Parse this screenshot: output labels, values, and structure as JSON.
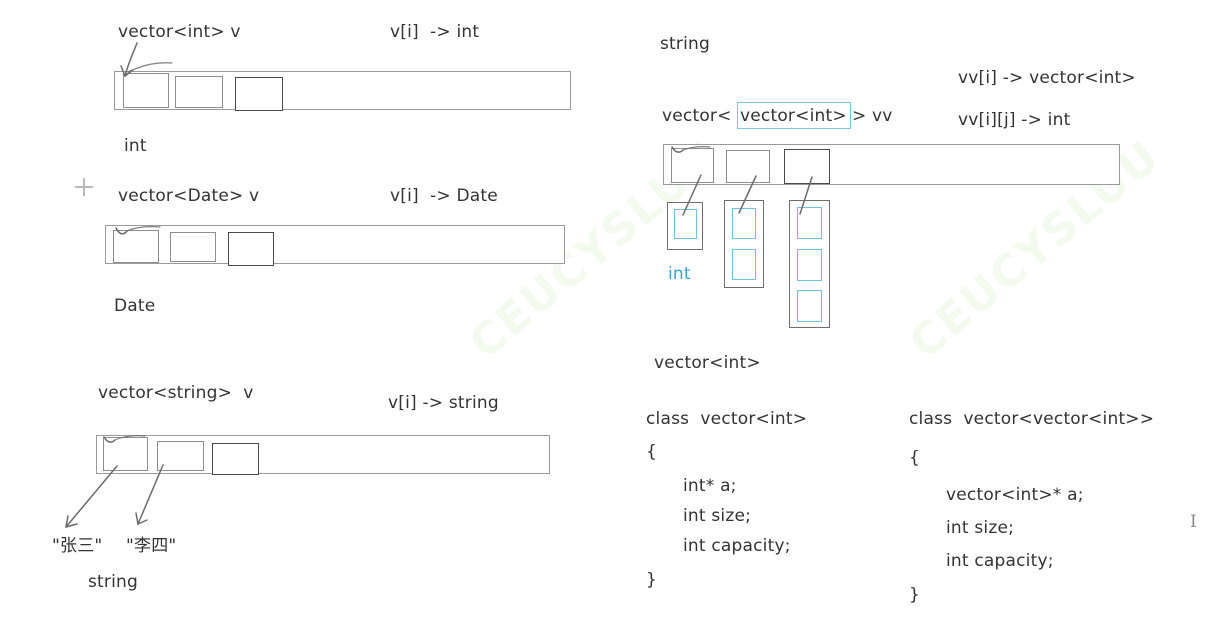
{
  "diagram": {
    "title_hidden": "",
    "watermarks": [
      "CEUCYSLUU",
      "CEUCYSLUU"
    ],
    "left_column": {
      "blocks": [
        {
          "id": "vector-int",
          "declaration": "vector<int> v",
          "indexing": "v[i]  -> int",
          "element_type": "int",
          "cells": 3
        },
        {
          "id": "vector-date",
          "declaration": "vector<Date> v",
          "indexing": "v[i]  -> Date",
          "element_type": "Date",
          "cells": 3
        },
        {
          "id": "vector-string",
          "declaration": "vector<string>  v",
          "indexing": "v[i] -> string",
          "element_type": "string",
          "cells": 3,
          "value_labels": [
            "\"张三\"",
            "\"李四\""
          ]
        }
      ]
    },
    "right_column": {
      "top_label": "string",
      "declaration_prefix": "vector<",
      "declaration_highlight": "vector<int>",
      "declaration_suffix": "> vv",
      "indexing_1": "vv[i] -> vector<int>",
      "indexing_2": "vv[i][j] -> int",
      "inner_type_label": "int",
      "element_type_label": "vector<int>",
      "outer_cells": 3,
      "inner_counts": [
        1,
        2,
        3
      ]
    },
    "class_defs": [
      {
        "id": "class-vector-int",
        "header": "class  vector<int>",
        "open_brace": "{",
        "members": [
          "int* a;",
          "int size;",
          "int capacity;"
        ],
        "close_brace": "}"
      },
      {
        "id": "class-vector-vector-int",
        "header": "class  vector<vector<int>>",
        "open_brace": "{",
        "members": [
          "vector<int>* a;",
          "int size;",
          "int capacity;"
        ],
        "close_brace": "}"
      }
    ],
    "cursor_glyph": "I",
    "colors": {
      "ink": "#333333",
      "accent_blue": "#6ec1e4",
      "box_gray": "#8e8e8e",
      "box_dark": "#4a4a4a"
    }
  }
}
